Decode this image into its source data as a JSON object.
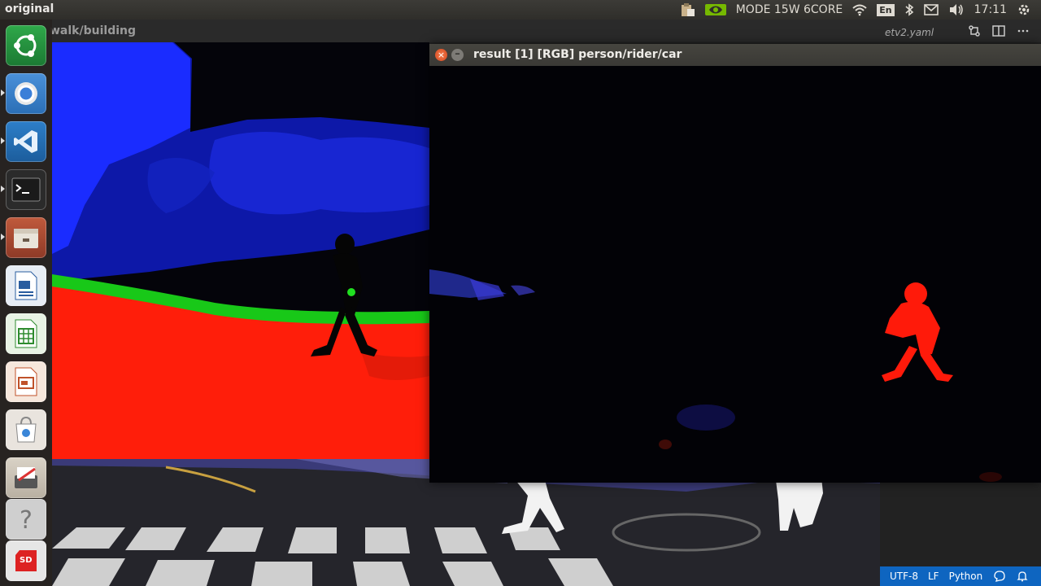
{
  "topbar": {
    "window_title": "original",
    "mode": "MODE 15W 6CORE",
    "keyboard_lang": "En",
    "clock": "17:11"
  },
  "launcher": {
    "items": [
      {
        "name": "ubuntu-dash-icon"
      },
      {
        "name": "chromium-icon"
      },
      {
        "name": "vscode-icon"
      },
      {
        "name": "terminal-icon"
      },
      {
        "name": "files-icon"
      },
      {
        "name": "writer-icon"
      },
      {
        "name": "calc-icon"
      },
      {
        "name": "impress-icon"
      },
      {
        "name": "software-center-icon"
      },
      {
        "name": "text-editor-icon"
      },
      {
        "name": "help-icon"
      },
      {
        "name": "sd-card-icon"
      }
    ],
    "sd_label": "SD"
  },
  "editor": {
    "breadcrumb": "walk/building",
    "yaml_tab": "etv2.yaml"
  },
  "statusbar": {
    "encoding": "UTF-8",
    "eol": "LF",
    "language": "Python"
  },
  "result_window": {
    "title": "result [1] [RGB] person/rider/car"
  },
  "colors": {
    "segment_person": "#ff1a0a",
    "segment_road": "#ff1e0a",
    "segment_sky": "#1020ff",
    "segment_vegetation": "#20e020",
    "statusbar": "#0e65c0"
  }
}
